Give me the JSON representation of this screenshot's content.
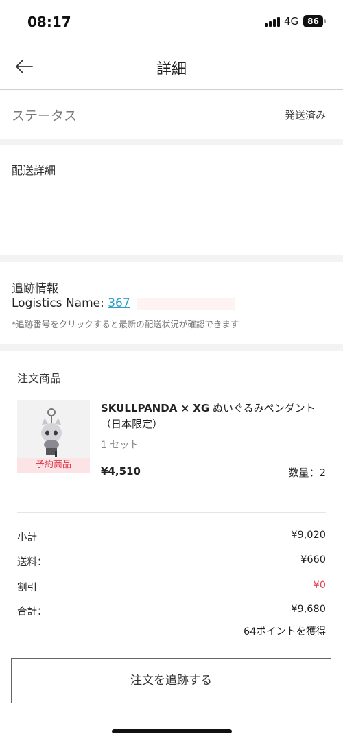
{
  "status_bar": {
    "time": "08:17",
    "network": "4G",
    "battery": "86"
  },
  "header": {
    "title": "詳細",
    "back_icon": "arrow-left-icon"
  },
  "status": {
    "label": "ステータス",
    "value": "発送済み"
  },
  "delivery": {
    "title": "配送詳細"
  },
  "tracking": {
    "title": "追跡情報",
    "logistics_label": "Logistics Name: ",
    "tracking_number": "367",
    "note": "*追跡番号をクリックすると最新の配送状況が確認できます"
  },
  "order": {
    "title": "注文商品",
    "product": {
      "name_brand": "SKULLPANDA × XG",
      "name_rest": " ぬいぐるみペンダント（日本限定）",
      "variant": "1 セット",
      "price": "¥4,510",
      "quantity": "数量：2",
      "badge": "予約商品"
    },
    "summary": [
      {
        "label": "小計",
        "value": "¥9,020",
        "color": "#222222"
      },
      {
        "label": "送料：",
        "value": "¥660",
        "color": "#222222"
      },
      {
        "label": "割引",
        "value": "¥0",
        "color": "#e0404f"
      },
      {
        "label": "合計：",
        "value": "¥9,680",
        "color": "#222222"
      }
    ],
    "points": "64ポイントを獲得",
    "track_button": "注文を追跡する"
  },
  "colors": {
    "accent_link": "#2aa0c8",
    "badge_text": "#e0404f",
    "badge_bg": "#fbe3e6"
  }
}
